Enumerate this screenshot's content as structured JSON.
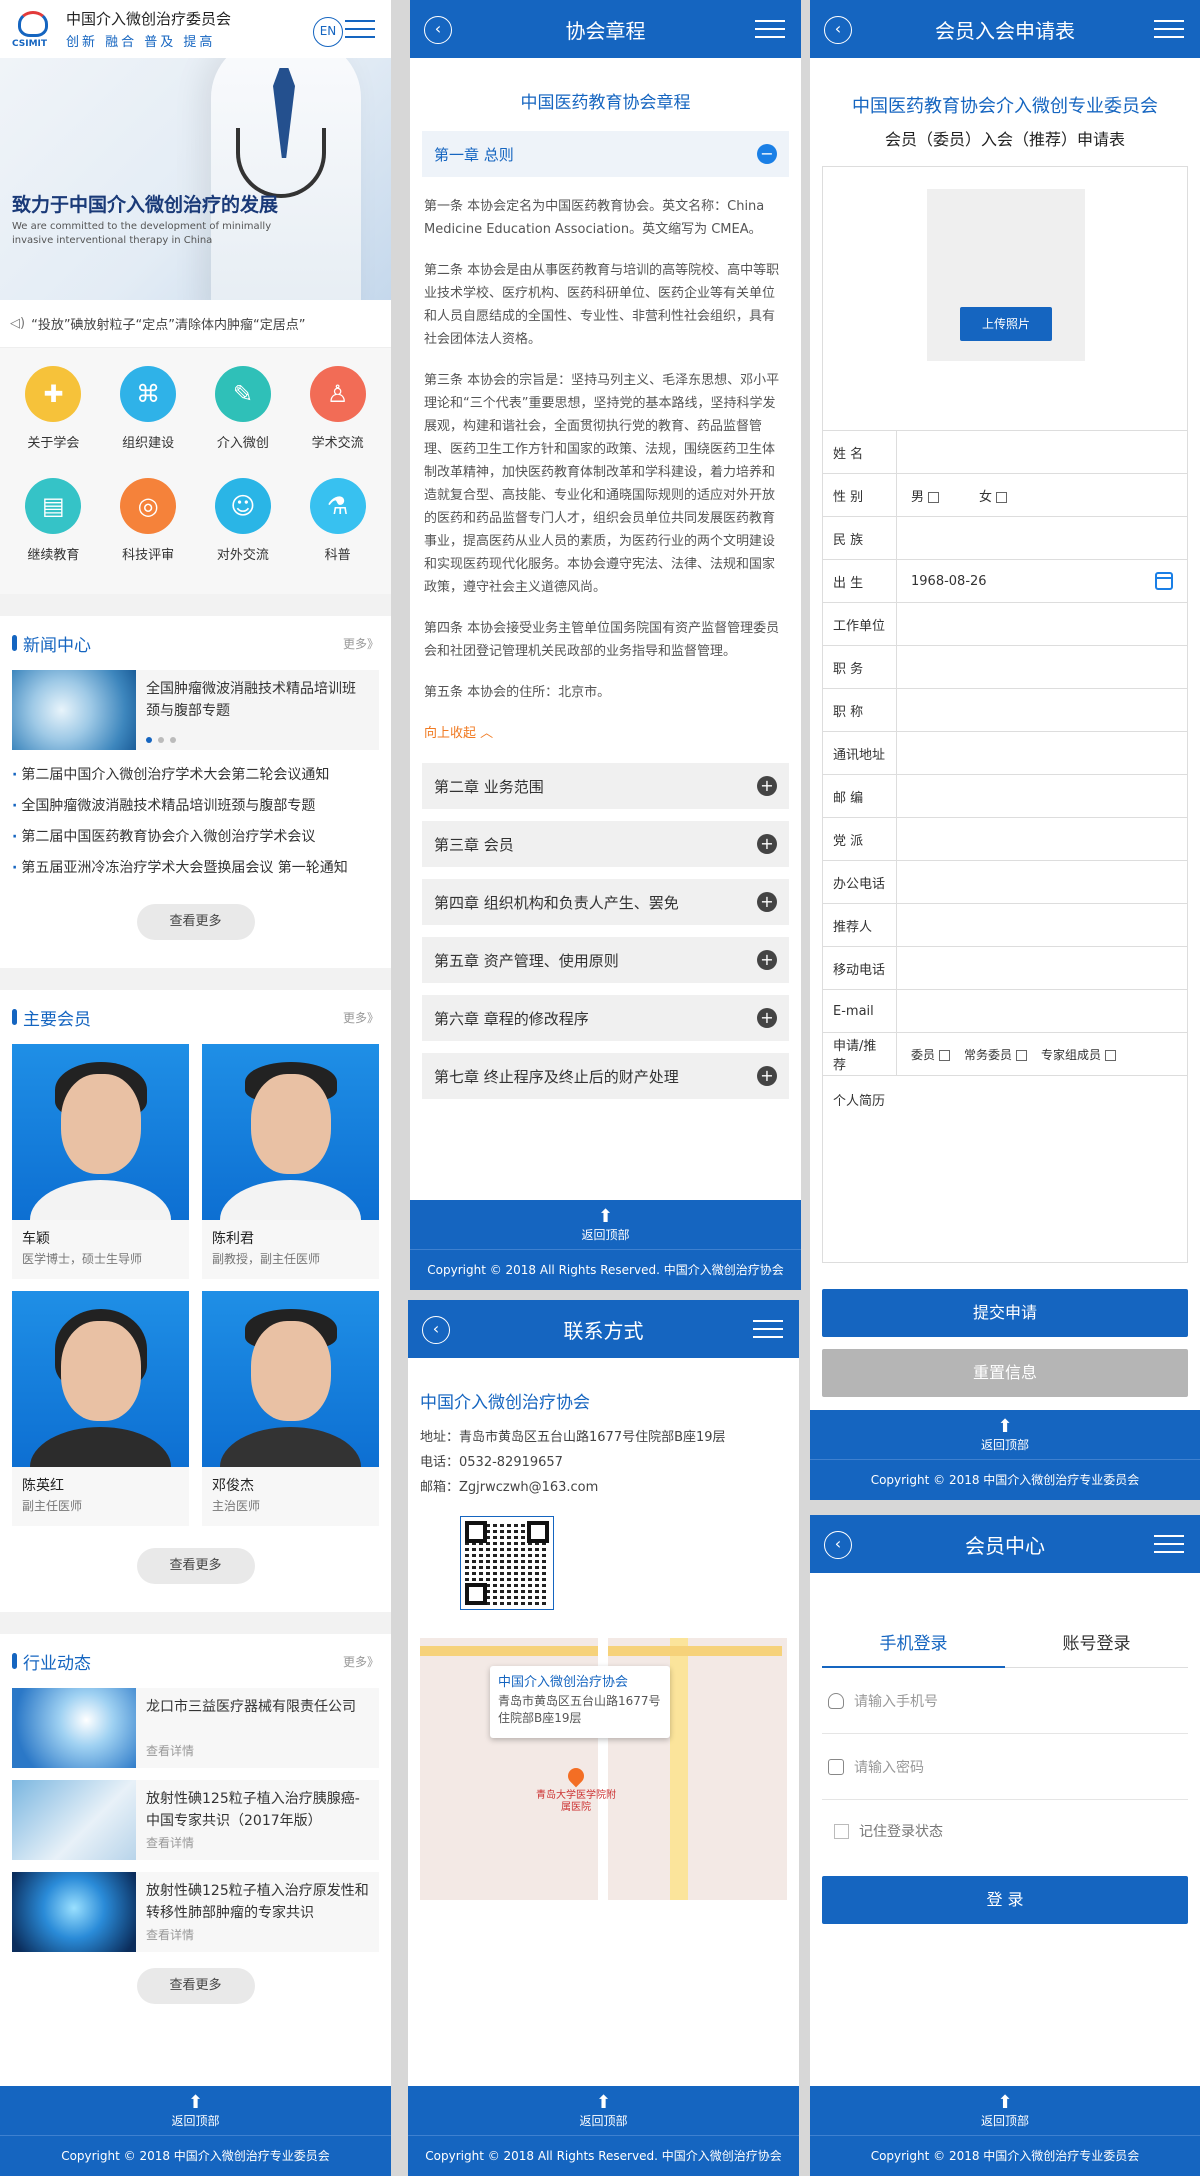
{
  "p1": {
    "logo_mark": "CSIMIT",
    "org_name": "中国介入微创治疗委员会",
    "slogan": "创新  融合  普及  提高",
    "lang": "EN",
    "banner_title": "致力于中国介入微创治疗的发展",
    "banner_sub": "We are committed to the development of minimally invasive interventional therapy in China",
    "notice": "“投放”碘放射粒子“定点”清除体内肿瘤“定居点”",
    "icons": [
      {
        "label": "关于学会",
        "color": "#f6c23a",
        "icon": "clipboard-icon"
      },
      {
        "label": "组织建设",
        "color": "#2fb2e8",
        "icon": "network-icon"
      },
      {
        "label": "介入微创",
        "color": "#2fc0b8",
        "icon": "syringe-icon"
      },
      {
        "label": "学术交流",
        "color": "#f26c56",
        "icon": "podium-icon"
      },
      {
        "label": "继续教育",
        "color": "#35c3c7",
        "icon": "book-icon"
      },
      {
        "label": "科技评审",
        "color": "#f5823a",
        "icon": "planet-icon"
      },
      {
        "label": "对外交流",
        "color": "#2ab5e6",
        "icon": "chat-icon"
      },
      {
        "label": "科普",
        "color": "#38c1f0",
        "icon": "flask-icon"
      }
    ],
    "news": {
      "title": "新闻中心",
      "more": "更多》",
      "featured": "全国肿瘤微波消融技术精品培训班 颈与腹部专题",
      "items": [
        "第二届中国介入微创治疗学术大会第二轮会议通知",
        "全国肿瘤微波消融技术精品培训班颈与腹部专题",
        "第二届中国医药教育协会介入微创治疗学术会议",
        "第五届亚洲冷冻治疗学术大会暨换届会议 第一轮通知"
      ],
      "btn": "查看更多"
    },
    "members": {
      "title": "主要会员",
      "more": "更多》",
      "btn": "查看更多",
      "list": [
        {
          "name": "车颖",
          "title": "医学博士，硕士生导师"
        },
        {
          "name": "陈利君",
          "title": "副教授，副主任医师"
        },
        {
          "name": "陈英红",
          "title": "副主任医师"
        },
        {
          "name": "邓俊杰",
          "title": "主治医师"
        }
      ]
    },
    "industry": {
      "title": "行业动态",
      "more": "更多》",
      "btn": "查看更多",
      "list": [
        {
          "title": "龙口市三益医疗器械有限责任公司",
          "detail": "查看详情"
        },
        {
          "title": "放射性碘125粒子植入治疗胰腺癌-中国专家共识（2017年版）",
          "detail": "查看详情"
        },
        {
          "title": "放射性碘125粒子植入治疗原发性和转移性肺部肿瘤的专家共识",
          "detail": "查看详情"
        }
      ]
    },
    "footer": {
      "top": "返回顶部",
      "copy": "Copyright © 2018  中国介入微创治疗专业委员会"
    }
  },
  "p2": {
    "header": "协会章程",
    "title": "中国医药教育协会章程",
    "open_chapter": "第一章 总则",
    "articles": [
      "第一条 本协会定名为中国医药教育协会。英文名称：China Medicine Education Association。英文缩写为 CMEA。",
      "第二条 本协会是由从事医药教育与培训的高等院校、高中等职业技术学校、医疗机构、医药科研单位、医药企业等有关单位和人员自愿结成的全国性、专业性、非营利性社会组织，具有社会团体法人资格。",
      "第三条 本协会的宗旨是：坚持马列主义、毛泽东思想、邓小平理论和“三个代表”重要思想，坚持党的基本路线，坚持科学发展观，构建和谐社会，全面贯彻执行党的教育、药品监督管理、医药卫生工作方针和国家的政策、法规，围绕医药卫生体制改革精神，加快医药教育体制改革和学科建设，着力培养和造就复合型、高技能、专业化和通晓国际规则的适应对外开放的医药和药品监督专门人才，组织会员单位共同发展医药教育事业，提高医药从业人员的素质，为医药行业的两个文明建设和实现医药现代化服务。本协会遵守宪法、法律、法规和国家政策，遵守社会主义道德风尚。",
      "第四条 本协会接受业务主管单位国务院国有资产监督管理委员会和社团登记管理机关民政部的业务指导和监督管理。",
      "第五条 本协会的住所：北京市。"
    ],
    "collapse": "向上收起",
    "chapters": [
      "第二章 业务范围",
      "第三章 会员",
      "第四章 组织机构和负责人产生、罢免",
      "第五章 资产管理、使用原则",
      "第六章 章程的修改程序",
      "第七章 终止程序及终止后的财产处理"
    ],
    "footer": {
      "top": "返回顶部",
      "copy": "Copyright © 2018 All Rights Reserved. 中国介入微创治疗协会"
    }
  },
  "p3": {
    "header": "联系方式",
    "org": "中国介入微创治疗协会",
    "address": "地址：青岛市黄岛区五台山路1677号住院部B座19层",
    "phone": "电话：0532-82919657",
    "email": "邮箱：Zgjrwczwh@163.com",
    "map": {
      "popup_title": "中国介入微创治疗协会",
      "popup_addr": "青岛市黄岛区五台山路1677号住院部B座19层",
      "hospital": "青岛大学医学院附属医院"
    },
    "footer": {
      "top": "返回顶部",
      "copy": "Copyright © 2018 All Rights Reserved. 中国介入微创治疗协会"
    }
  },
  "p4": {
    "header": "会员入会申请表",
    "title1": "中国医药教育协会介入微创专业委员会",
    "title2": "会员（委员）入会（推荐）申请表",
    "upload": "上传照片",
    "fields": [
      "姓 名",
      "性 别",
      "民 族",
      "出 生",
      "工作单位",
      "职 务",
      "职 称",
      "通讯地址",
      "邮 编",
      "党 派",
      "办公电话",
      "推荐人",
      "移动电话",
      "E-mail",
      "申请/推荐"
    ],
    "gender": [
      "男",
      "女"
    ],
    "birth": "1968-08-26",
    "apply": [
      "委员",
      "常务委员",
      "专家组成员"
    ],
    "resume": "个人简历",
    "submit": "提交申请",
    "reset": "重置信息",
    "footer": {
      "top": "返回顶部",
      "copy": "Copyright © 2018  中国介入微创治疗专业委员会"
    }
  },
  "p5": {
    "header": "会员中心",
    "tab_phone": "手机登录",
    "tab_account": "账号登录",
    "ph_phone": "请输入手机号",
    "ph_password": "请输入密码",
    "remember": "记住登录状态",
    "login": "登 录",
    "footer": {
      "top": "返回顶部",
      "copy": "Copyright © 2018  中国介入微创治疗专业委员会"
    }
  }
}
